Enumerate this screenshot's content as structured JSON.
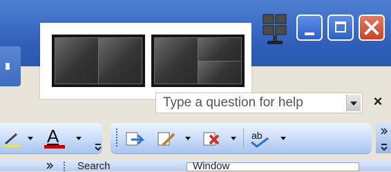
{
  "window_controls": {
    "minimize": "minimize",
    "maximize": "maximize",
    "close": "close"
  },
  "layout_popup": {
    "layouts": [
      "two-panes-side-by-side",
      "one-left-two-right"
    ]
  },
  "help": {
    "placeholder": "Type a question for help"
  },
  "toolbar": {
    "font_color_letter": "A",
    "spelling_label": "ab"
  },
  "row2": {
    "search_text": "Search",
    "window_text": "Window"
  },
  "colors": {
    "titlebar": "#3e6fc6",
    "close_button": "#c7432d",
    "popup_background": "#ffffff",
    "pane_dark": "#343434"
  }
}
